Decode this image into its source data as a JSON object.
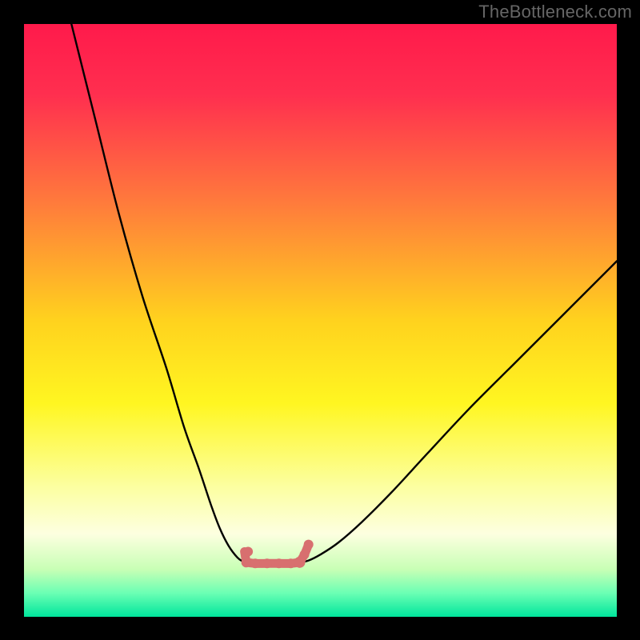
{
  "watermark": "TheBottleneck.com",
  "chart_data": {
    "type": "line",
    "title": "",
    "xlabel": "",
    "ylabel": "",
    "xlim": [
      0,
      100
    ],
    "ylim": [
      0,
      100
    ],
    "gradient_stops": [
      {
        "offset": 0.0,
        "color": "#ff1a4b"
      },
      {
        "offset": 0.12,
        "color": "#ff2f4f"
      },
      {
        "offset": 0.3,
        "color": "#ff7a3c"
      },
      {
        "offset": 0.5,
        "color": "#ffd21e"
      },
      {
        "offset": 0.64,
        "color": "#fff621"
      },
      {
        "offset": 0.78,
        "color": "#fcffa0"
      },
      {
        "offset": 0.86,
        "color": "#fdffe0"
      },
      {
        "offset": 0.92,
        "color": "#c8ffb5"
      },
      {
        "offset": 0.96,
        "color": "#6bffb4"
      },
      {
        "offset": 1.0,
        "color": "#00e59c"
      }
    ],
    "series": [
      {
        "name": "curve-left",
        "x": [
          8.0,
          12.0,
          16.0,
          20.0,
          24.0,
          27.0,
          29.5,
          31.5,
          33.0,
          34.5,
          36.0,
          37.0,
          37.5
        ],
        "y": [
          100.0,
          84.0,
          68.0,
          54.0,
          42.0,
          32.0,
          25.0,
          19.0,
          15.0,
          12.0,
          10.0,
          9.3,
          9.2
        ]
      },
      {
        "name": "bottom-flat",
        "x": [
          37.5,
          39.0,
          41.0,
          43.0,
          45.0,
          46.5
        ],
        "y": [
          9.2,
          9.0,
          9.0,
          9.0,
          9.0,
          9.2
        ]
      },
      {
        "name": "curve-right",
        "x": [
          46.5,
          48.0,
          50.0,
          53.0,
          57.0,
          62.0,
          68.0,
          75.0,
          83.0,
          91.0,
          100.0
        ],
        "y": [
          9.2,
          9.5,
          10.5,
          12.5,
          16.0,
          21.0,
          27.5,
          35.0,
          43.0,
          51.0,
          60.0
        ]
      }
    ],
    "markers": {
      "name": "bottom-markers",
      "color": "#d86f6f",
      "points": [
        {
          "x": 37.5,
          "y": 9.2,
          "r": 6
        },
        {
          "x": 37.8,
          "y": 11.0,
          "r": 6
        },
        {
          "x": 39.0,
          "y": 9.0,
          "r": 6
        },
        {
          "x": 41.0,
          "y": 9.0,
          "r": 6
        },
        {
          "x": 43.0,
          "y": 9.0,
          "r": 6
        },
        {
          "x": 45.0,
          "y": 9.0,
          "r": 6
        },
        {
          "x": 46.5,
          "y": 9.2,
          "r": 7
        },
        {
          "x": 47.3,
          "y": 10.5,
          "r": 6
        },
        {
          "x": 48.0,
          "y": 12.2,
          "r": 6
        }
      ]
    }
  }
}
